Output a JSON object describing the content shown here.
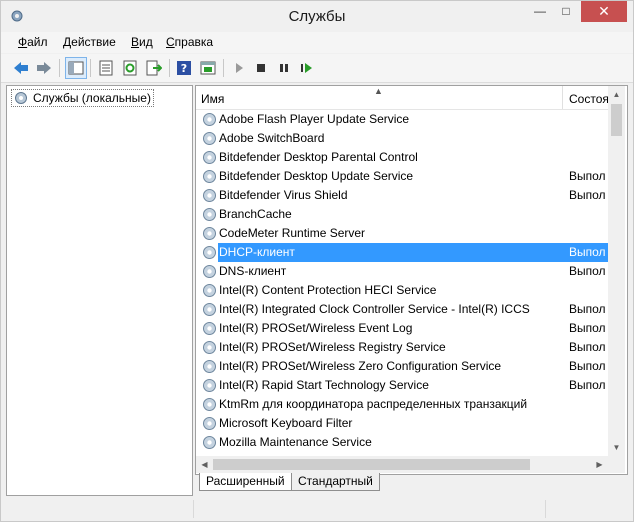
{
  "window": {
    "title": "Службы"
  },
  "menu": [
    "Файл",
    "Действие",
    "Вид",
    "Справка"
  ],
  "menu_accel": [
    "Ф",
    "Д",
    "В",
    "С"
  ],
  "tree": {
    "root_label": "Службы (локальные)"
  },
  "list": {
    "columns": {
      "name": "Имя",
      "status": "Состоя"
    },
    "rows": [
      {
        "name": "Adobe Flash Player Update Service",
        "status": ""
      },
      {
        "name": "Adobe SwitchBoard",
        "status": ""
      },
      {
        "name": "Bitdefender Desktop Parental Control",
        "status": ""
      },
      {
        "name": "Bitdefender Desktop Update Service",
        "status": "Выпол"
      },
      {
        "name": "Bitdefender Virus Shield",
        "status": "Выпол"
      },
      {
        "name": "BranchCache",
        "status": ""
      },
      {
        "name": "CodeMeter Runtime Server",
        "status": ""
      },
      {
        "name": "DHCP-клиент",
        "status": "Выпол",
        "selected": true
      },
      {
        "name": "DNS-клиент",
        "status": "Выпол"
      },
      {
        "name": "Intel(R) Content Protection HECI Service",
        "status": ""
      },
      {
        "name": "Intel(R) Integrated Clock Controller Service - Intel(R) ICCS",
        "status": "Выпол"
      },
      {
        "name": "Intel(R) PROSet/Wireless Event Log",
        "status": "Выпол"
      },
      {
        "name": "Intel(R) PROSet/Wireless Registry Service",
        "status": "Выпол"
      },
      {
        "name": "Intel(R) PROSet/Wireless Zero Configuration Service",
        "status": "Выпол"
      },
      {
        "name": "Intel(R) Rapid Start Technology Service",
        "status": "Выпол"
      },
      {
        "name": "KtmRm для координатора распределенных транзакций",
        "status": ""
      },
      {
        "name": "Microsoft Keyboard Filter",
        "status": ""
      },
      {
        "name": "Mozilla Maintenance Service",
        "status": ""
      }
    ]
  },
  "tabs": [
    "Расширенный",
    "Стандартный"
  ],
  "toolbar": [
    "back-icon",
    "forward-icon",
    "show-tree-icon",
    "properties-icon",
    "refresh-icon",
    "export-icon",
    "help-icon",
    "console-icon",
    "play-icon",
    "stop-icon",
    "pause-icon",
    "restart-icon"
  ],
  "colors": {
    "selection": "#3399ff",
    "close_button": "#c75050"
  }
}
